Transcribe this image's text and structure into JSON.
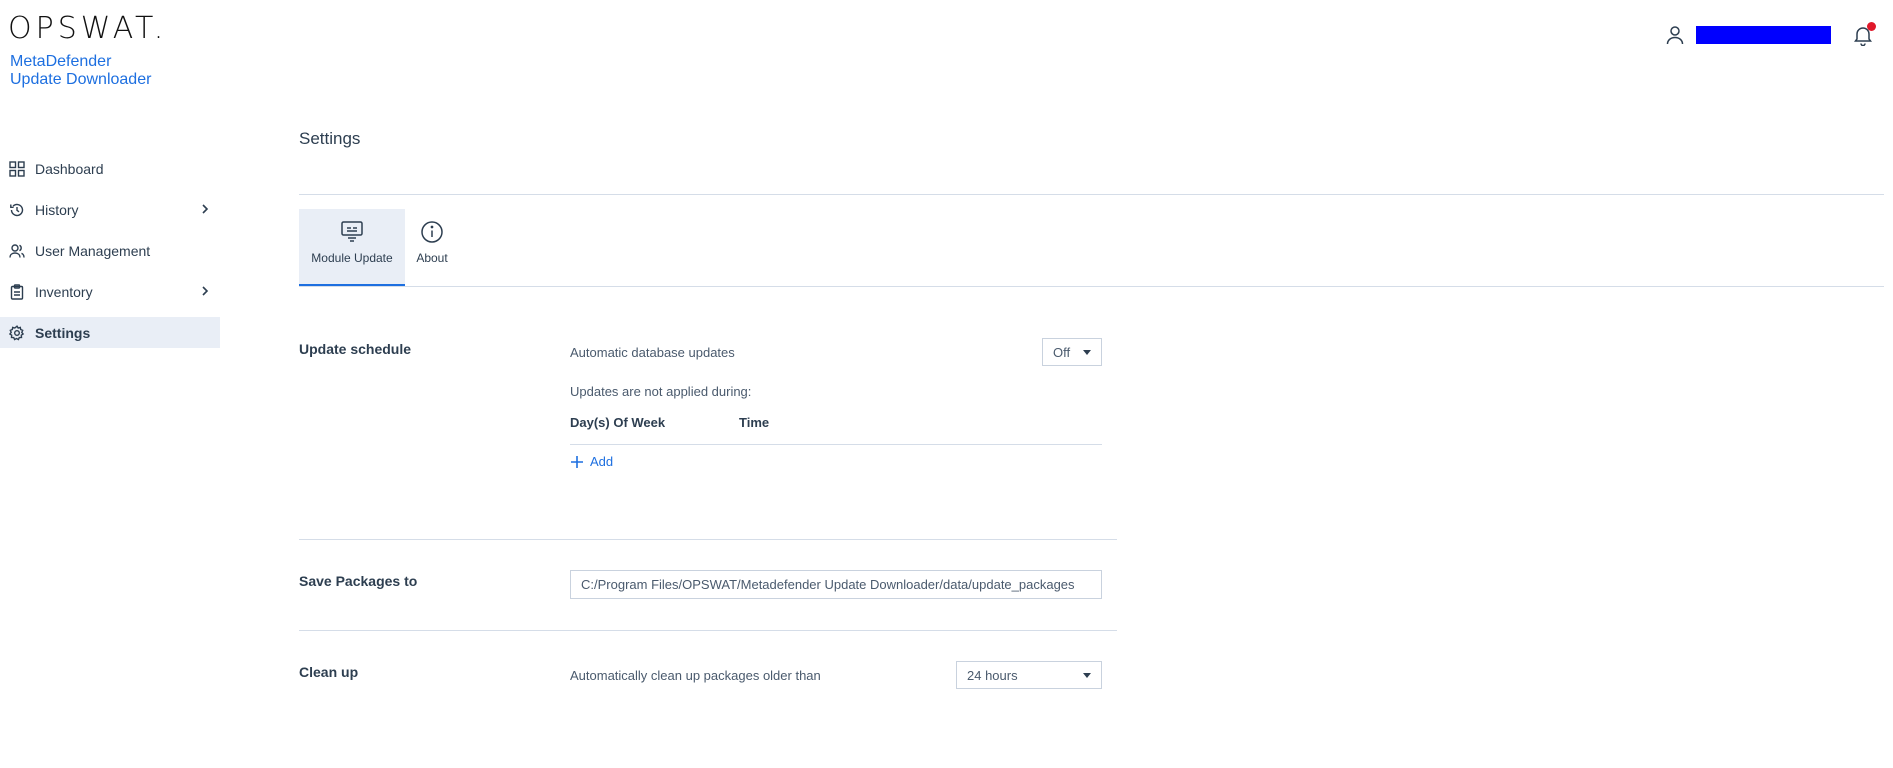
{
  "brand": {
    "logo": "OPSWAT.",
    "product_line1": "MetaDefender",
    "product_line2": "Update Downloader"
  },
  "header": {
    "user_name": "",
    "notification_color": "#e0182a",
    "redaction_color": "#0000ff"
  },
  "sidebar": {
    "items": [
      {
        "label": "Dashboard",
        "icon": "grid-icon",
        "expandable": false,
        "active": false
      },
      {
        "label": "History",
        "icon": "history-icon",
        "expandable": true,
        "active": false
      },
      {
        "label": "User Management",
        "icon": "users-icon",
        "expandable": false,
        "active": false
      },
      {
        "label": "Inventory",
        "icon": "clipboard-icon",
        "expandable": true,
        "active": false
      },
      {
        "label": "Settings",
        "icon": "gear-icon",
        "expandable": false,
        "active": true
      }
    ]
  },
  "page": {
    "title": "Settings",
    "tabs": [
      {
        "label": "Module Update",
        "icon": "module-icon",
        "active": true
      },
      {
        "label": "About",
        "icon": "info-icon",
        "active": false
      }
    ]
  },
  "update_schedule": {
    "label": "Update schedule",
    "auto_label": "Automatic database updates",
    "auto_value": "Off",
    "not_applied_label": "Updates are not applied during:",
    "col_days": "Day(s) Of Week",
    "col_time": "Time",
    "add_label": "Add"
  },
  "save_packages": {
    "label": "Save Packages to",
    "path": "C:/Program Files/OPSWAT/Metadefender Update Downloader/data/update_packages"
  },
  "clean_up": {
    "label": "Clean up",
    "text": "Automatically clean up packages older than",
    "value": "24 hours"
  },
  "colors": {
    "accent": "#1d6fe0",
    "active_bg": "#e9eef6",
    "text": "#2d3e50"
  }
}
